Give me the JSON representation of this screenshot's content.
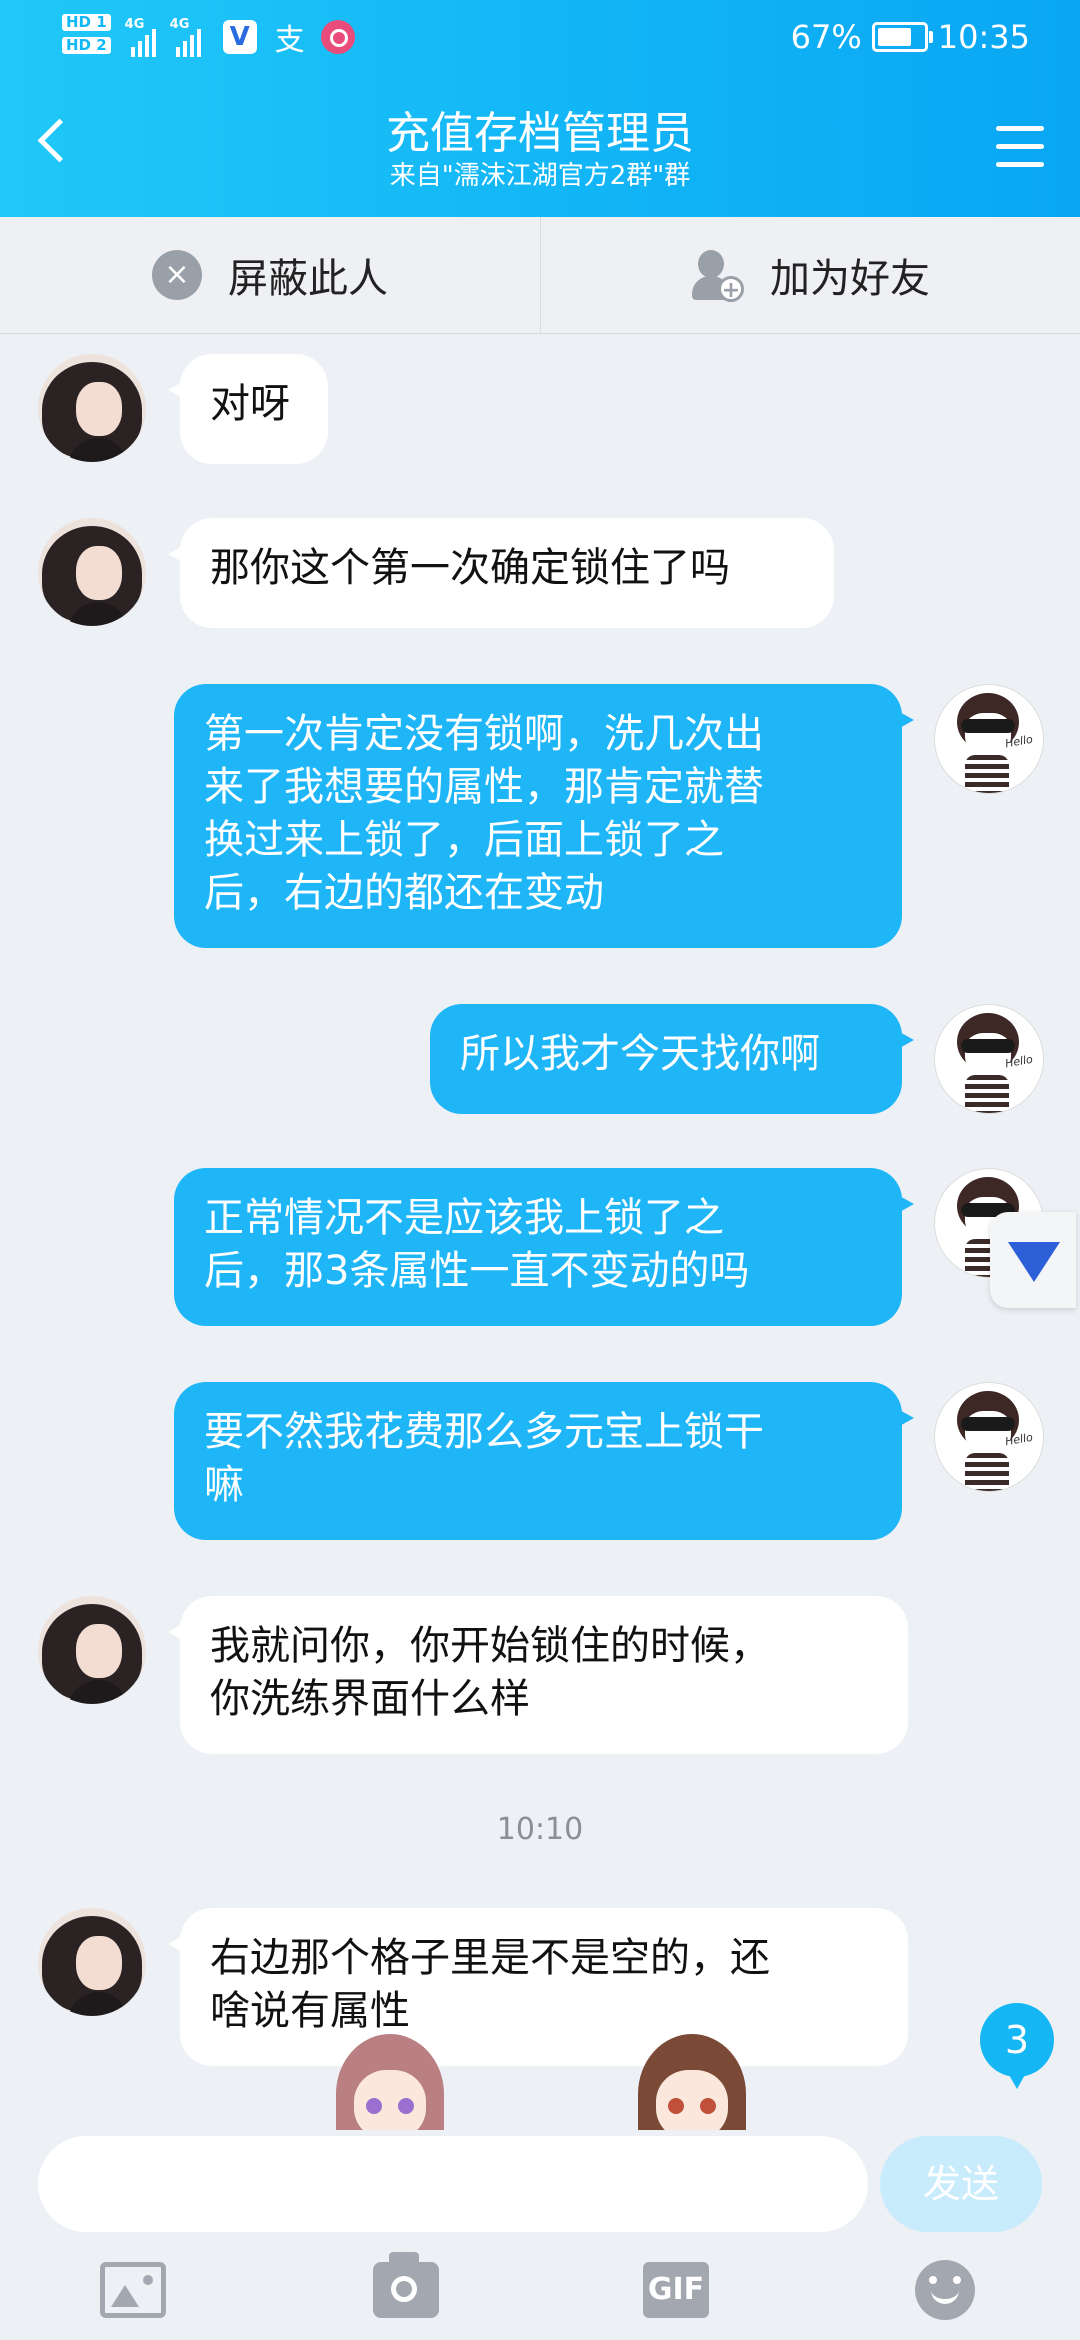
{
  "status_bar": {
    "hd1": "HD 1",
    "hd2": "HD 2",
    "net1": "4G",
    "net2": "4G",
    "battery_text": "67%",
    "battery_level": 0.67,
    "time": "10:35"
  },
  "header": {
    "title": "充值存档管理员",
    "subtitle": "来自\"濡沫江湖官方2群\"群"
  },
  "actions": {
    "block_label": "屏蔽此人",
    "add_friend_label": "加为好友"
  },
  "messages": [
    {
      "side": "in",
      "text": "对呀"
    },
    {
      "side": "in",
      "text": "那你这个第一次确定锁住了吗"
    },
    {
      "side": "out",
      "text": "第一次肯定没有锁啊，洗几次出\n来了我想要的属性，那肯定就替\n换过来上锁了，后面上锁了之\n后，右边的都还在变动"
    },
    {
      "side": "out",
      "text": "所以我才今天找你啊"
    },
    {
      "side": "out",
      "text": "正常情况不是应该我上锁了之\n后，那3条属性一直不变动的吗"
    },
    {
      "side": "out",
      "text": "要不然我花费那么多元宝上锁干\n嘛"
    },
    {
      "side": "in",
      "text": "我就问你，你开始锁住的时候，\n你洗练界面什么样"
    },
    {
      "side": "in",
      "text": "右边那个格子里是不是空的，还\n啥说有属性"
    }
  ],
  "timestamp": "10:10",
  "unread_count": "3",
  "input": {
    "placeholder": "",
    "send_label": "发送"
  },
  "toolbar": {
    "gif_label": "GIF",
    "icons": [
      "image-icon",
      "camera-icon",
      "gif-icon",
      "emoji-icon"
    ]
  },
  "colors": {
    "accent": "#1fb6f8",
    "header_start": "#20c8f8",
    "header_end": "#0aa6f4",
    "background": "#edf0f5"
  }
}
